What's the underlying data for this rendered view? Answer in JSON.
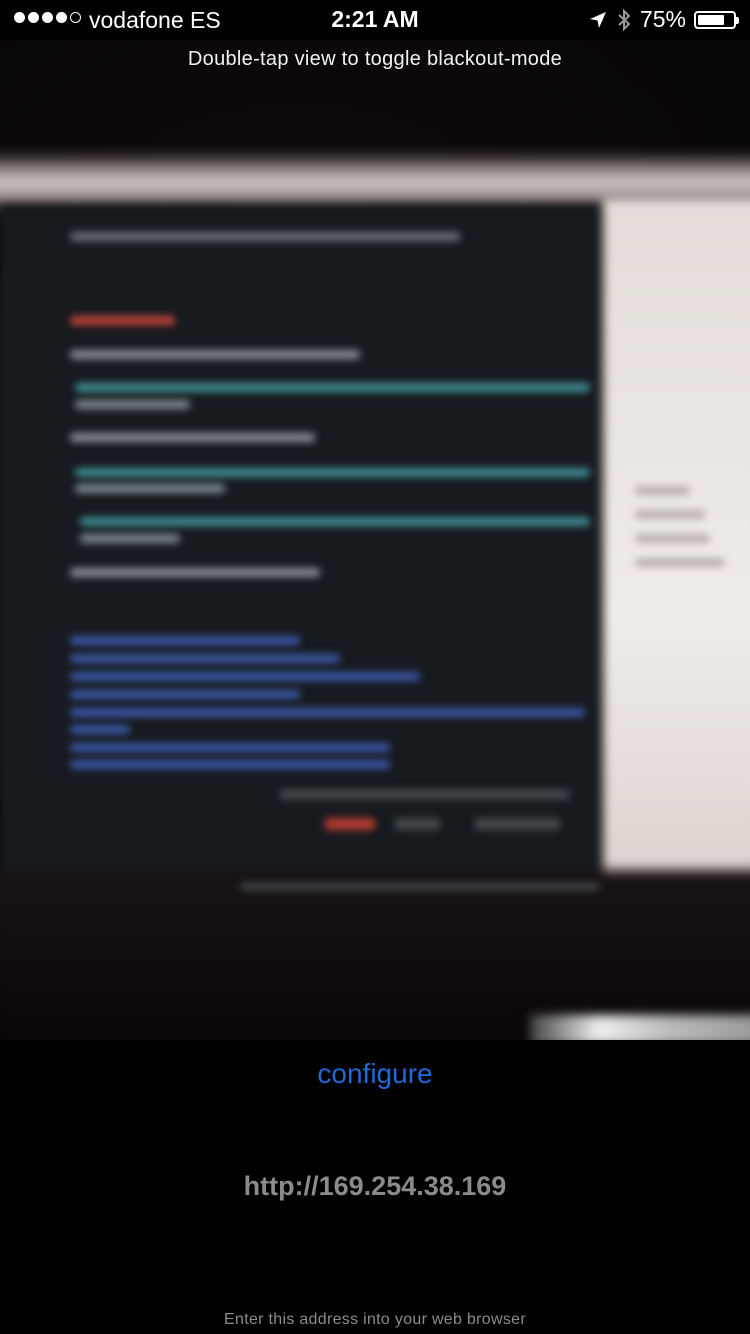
{
  "status_bar": {
    "signal_dots": 5,
    "signal_filled": 4,
    "carrier": "vodafone ES",
    "time": "2:21 AM",
    "location_icon": "location-arrow-icon",
    "bluetooth_icon": "bluetooth-icon",
    "battery_percent_label": "75%",
    "battery_level": 0.75
  },
  "camera_view": {
    "hint": "Double-tap view to toggle blackout-mode"
  },
  "footer": {
    "configure_label": "configure",
    "address": "http://169.254.38.169",
    "instructions": "Enter this address into your web browser"
  },
  "colors": {
    "link_blue": "#1d6ad8",
    "muted_gray": "#8b8b8b",
    "background": "#000000"
  }
}
